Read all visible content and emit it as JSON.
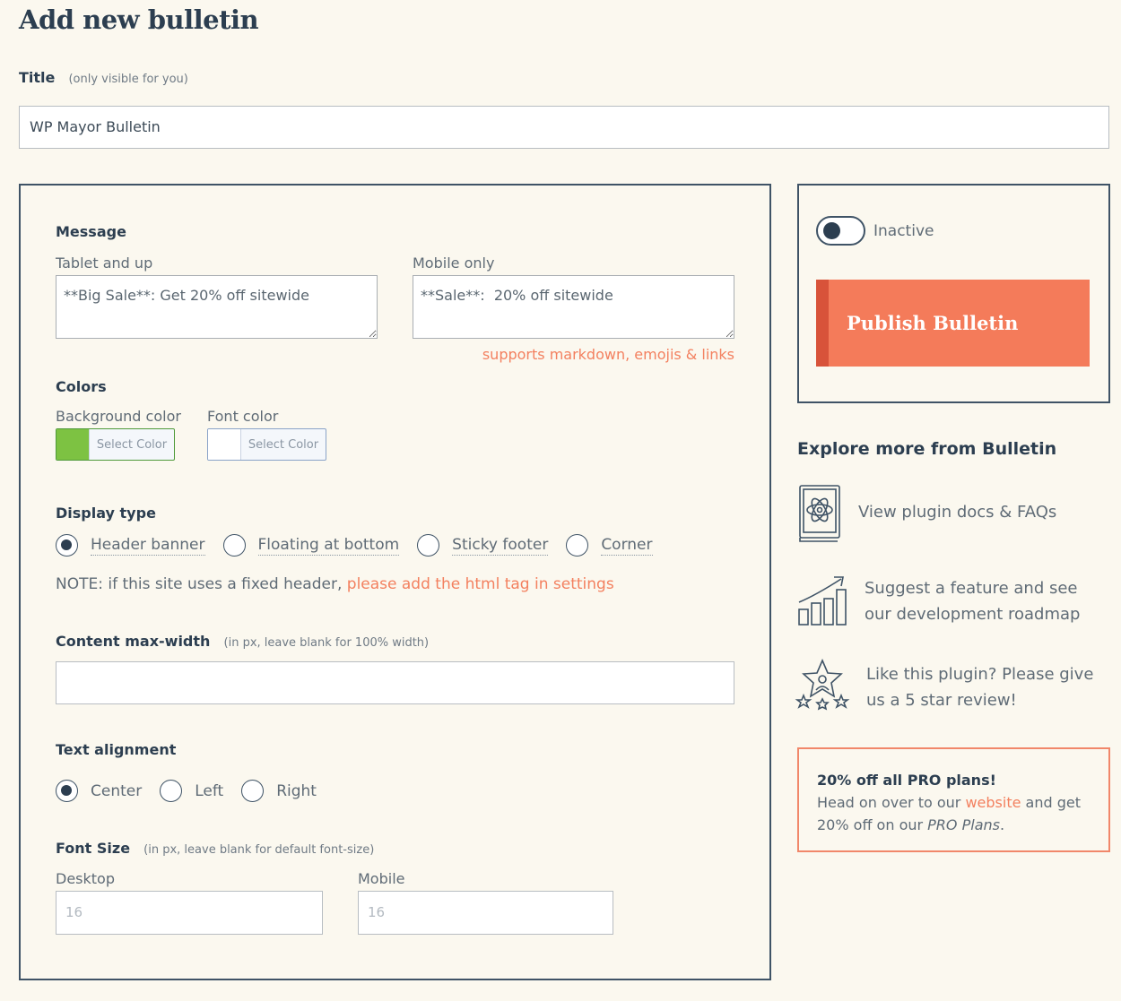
{
  "page": {
    "title": "Add new bulletin"
  },
  "title_field": {
    "label": "Title",
    "hint": "(only visible for you)",
    "value": "WP Mayor Bulletin"
  },
  "message": {
    "heading": "Message",
    "tablet_label": "Tablet and up",
    "tablet_value": "**Big Sale**: Get 20% off sitewide",
    "mobile_label": "Mobile only",
    "mobile_value": "**Sale**:  20% off sitewide",
    "markdown_note": "supports markdown, emojis & links"
  },
  "colors": {
    "heading": "Colors",
    "background_label": "Background color",
    "background_color": "#7dc242",
    "font_label": "Font color",
    "font_color": "#ffffff",
    "select_color_label": "Select Color"
  },
  "display_type": {
    "heading": "Display type",
    "options": [
      "Header banner",
      "Floating at bottom",
      "Sticky footer",
      "Corner"
    ],
    "selected": "Header banner",
    "note_prefix": "NOTE: if this site uses a fixed header, ",
    "note_link": "please add the html tag in settings"
  },
  "content_width": {
    "label": "Content max-width",
    "hint": "(in px, leave blank for 100% width)",
    "value": ""
  },
  "text_alignment": {
    "heading": "Text alignment",
    "options": [
      "Center",
      "Left",
      "Right"
    ],
    "selected": "Center"
  },
  "font_size": {
    "label": "Font Size",
    "hint": "(in px, leave blank for default font-size)",
    "desktop_label": "Desktop",
    "desktop_placeholder": "16",
    "mobile_label": "Mobile",
    "mobile_placeholder": "16"
  },
  "status": {
    "label": "Inactive",
    "active": false,
    "publish_label": "Publish Bulletin",
    "publish_color": "#f47b5a"
  },
  "explore": {
    "heading": "Explore more from Bulletin",
    "items": [
      {
        "icon": "book-atom-icon",
        "line1": "View plugin docs & FAQs",
        "line2": ""
      },
      {
        "icon": "growth-chart-icon",
        "line1": "Suggest a feature and see",
        "line2": "our development roadmap"
      },
      {
        "icon": "star-award-icon",
        "line1": "Like this plugin? Please give",
        "line2": "us a 5 star review!"
      }
    ]
  },
  "promo": {
    "heading": "20% off all PRO plans!",
    "text_before": "Head on over to our ",
    "link": "website",
    "text_after": " and get",
    "line2_prefix": "20% off on our ",
    "line2_italic": "PRO Plans",
    "line2_suffix": "."
  }
}
